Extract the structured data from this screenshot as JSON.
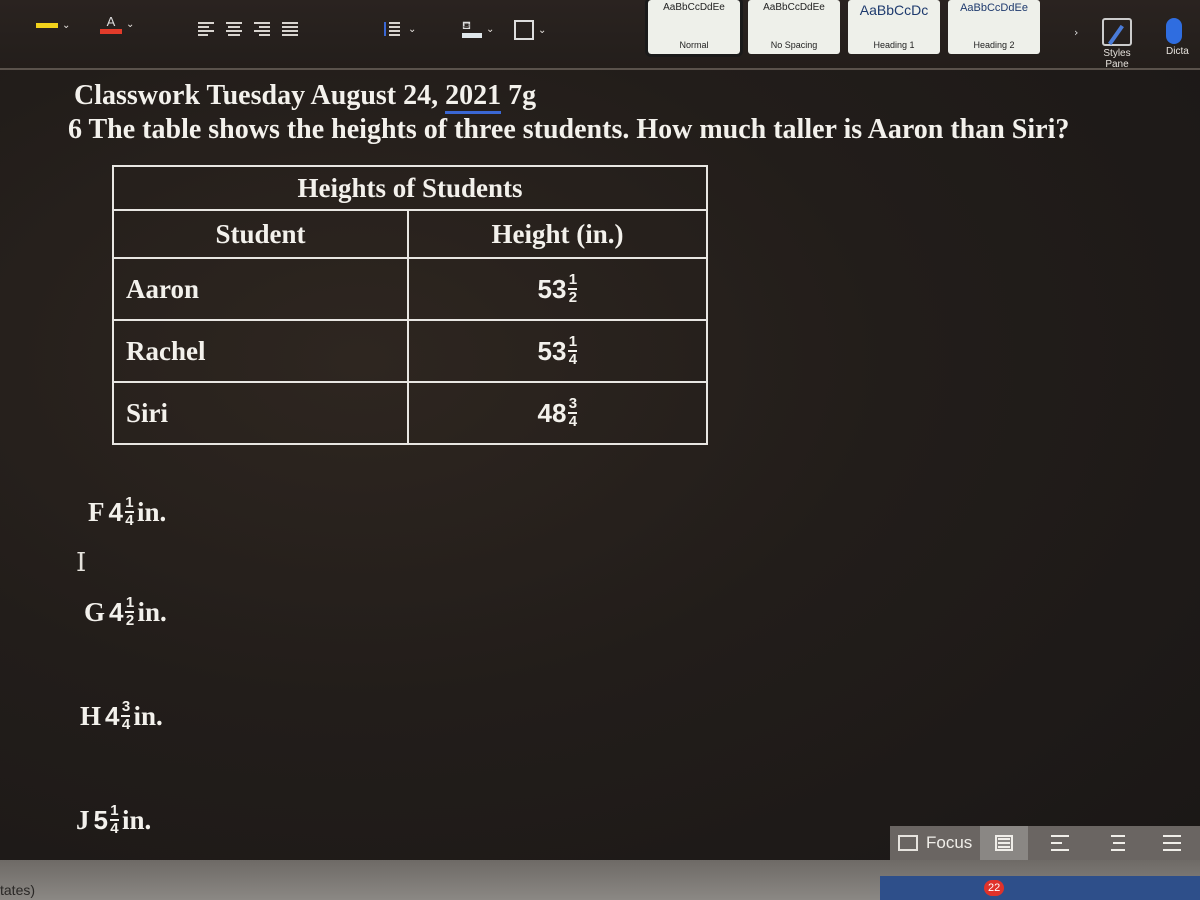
{
  "ribbon": {
    "styles": [
      {
        "preview": "AaBbCcDdEe",
        "name": "Normal",
        "selected": true
      },
      {
        "preview": "AaBbCcDdEe",
        "name": "No Spacing",
        "selected": false
      },
      {
        "preview": "AaBbCcDc",
        "name": "Heading 1",
        "selected": false
      },
      {
        "preview": "AaBbCcDdEe",
        "name": "Heading 2",
        "selected": false
      }
    ],
    "more_styles": "›",
    "styles_pane": "Styles Pane",
    "dictate": "Dicta",
    "highlight_color": "#f2d21b",
    "font_color": "#e23b2a"
  },
  "document": {
    "title_prefix": "Classwork Tuesday August 24, ",
    "title_year": "2021",
    "title_suffix": " 7g",
    "question": "6 The table shows the heights of three students. How much taller is Aaron than Siri?",
    "table": {
      "caption": "Heights of Students",
      "headers": [
        "Student",
        "Height (in.)"
      ],
      "rows": [
        {
          "student": "Aaron",
          "whole": "53",
          "num": "1",
          "den": "2"
        },
        {
          "student": "Rachel",
          "whole": "53",
          "num": "1",
          "den": "4"
        },
        {
          "student": "Siri",
          "whole": "48",
          "num": "3",
          "den": "4"
        }
      ]
    },
    "answers": [
      {
        "letter": "F",
        "whole": "4",
        "num": "1",
        "den": "4",
        "unit": "in."
      },
      {
        "letter": "G",
        "whole": "4",
        "num": "1",
        "den": "2",
        "unit": "in."
      },
      {
        "letter": "H",
        "whole": "4",
        "num": "3",
        "den": "4",
        "unit": "in."
      },
      {
        "letter": "J",
        "whole": "5",
        "num": "1",
        "den": "4",
        "unit": "in."
      }
    ],
    "cursor_glyph": "I"
  },
  "statusbar": {
    "left_text": "tates)",
    "focus_label": "Focus",
    "dock_badge": "22"
  }
}
